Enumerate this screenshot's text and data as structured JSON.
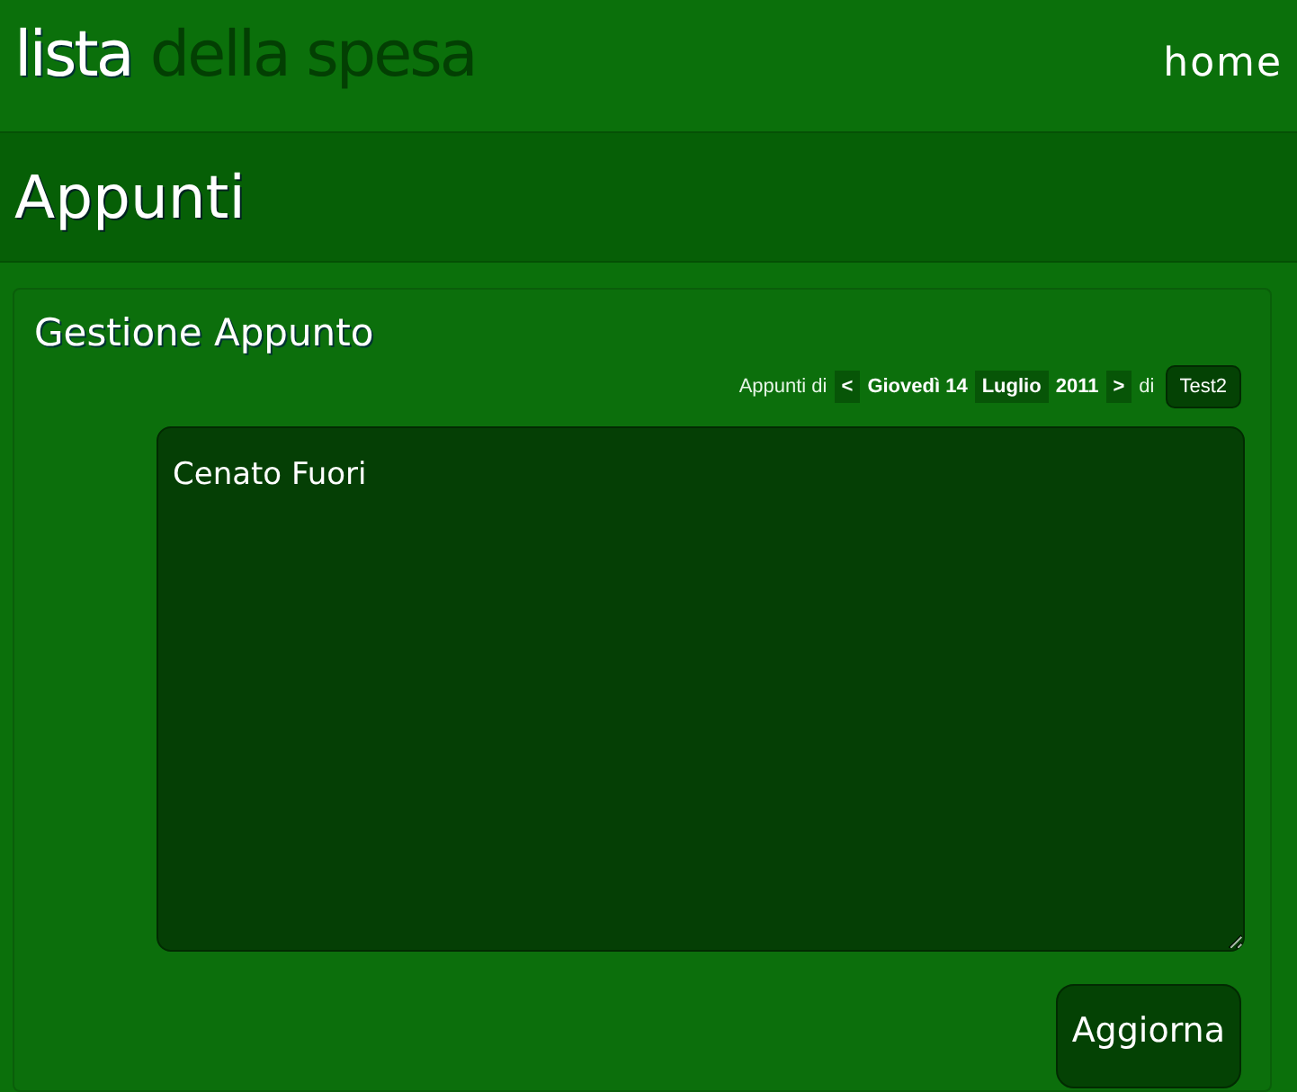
{
  "header": {
    "logo_first": "lista",
    "logo_rest": "della spesa",
    "nav": "home"
  },
  "page_title": "Appunti",
  "panel": {
    "heading": "Gestione Appunto",
    "date_nav": {
      "prefix": "Appunti di",
      "prev": "<",
      "day": "Giovedì 14",
      "month": "Luglio",
      "year": "2011",
      "next": ">",
      "of": "di",
      "user": "Test2"
    },
    "note": {
      "value": "Cenato Fuori"
    },
    "submit": "Aggiorna"
  }
}
